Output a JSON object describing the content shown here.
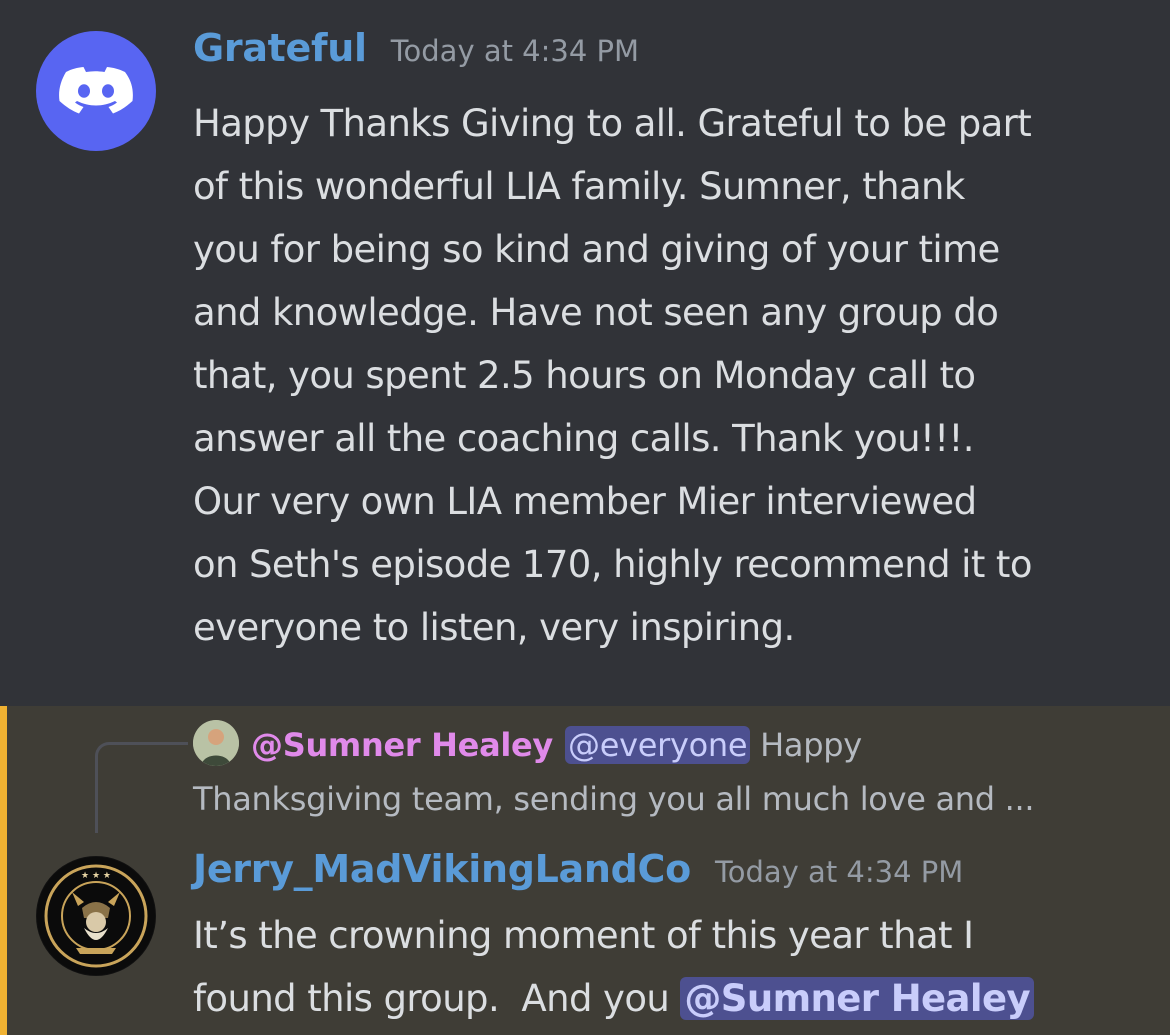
{
  "message1": {
    "author": "Grateful",
    "author_color": "#5A9BD8",
    "avatar_icon": "discord-logo-icon",
    "timestamp": "Today at 4:34 PM",
    "lines": [
      "Happy Thanks Giving to all. Grateful to be part",
      "of this wonderful LIA family. Sumner, thank",
      "you for being so kind and giving of your time",
      "and knowledge. Have not seen any group do",
      "that, you spent 2.5 hours on Monday call to",
      "answer all the coaching calls. Thank you!!!.",
      "Our very own LIA member Mier interviewed",
      "on Seth's episode 170, highly recommend it to",
      "everyone to listen, very inspiring."
    ]
  },
  "message2": {
    "highlight_color": "#F0B232",
    "reply": {
      "author": "@Sumner Healey",
      "mention": "@everyone",
      "text_line1": " Happy",
      "text_line2": "Thanksgiving team, sending you all much love and ..."
    },
    "author": "Jerry_MadVikingLandCo",
    "author_color": "#5A9BD8",
    "avatar_icon": "viking-badge-icon",
    "avatar_ring_text": "BUYING AMERICA SINCE 2015",
    "timestamp": "Today at 4:34 PM",
    "line1": "It’s the crowning moment of this year that I",
    "line2_prefix": "found this group.  And you ",
    "mention": "@Sumner Healey"
  }
}
